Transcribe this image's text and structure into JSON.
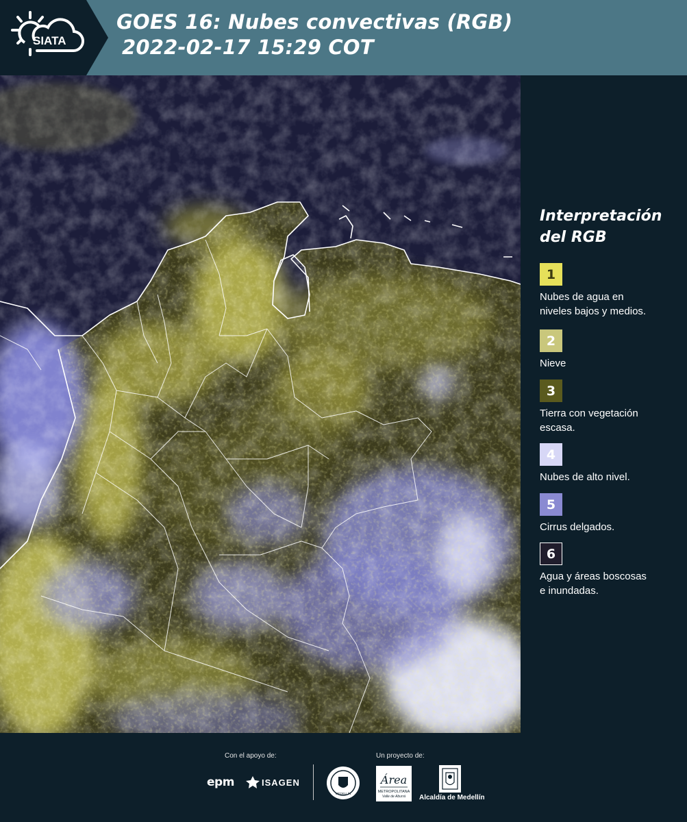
{
  "header": {
    "logo_text": "SIATA",
    "title_line1": "GOES 16: Nubes convectivas (RGB)",
    "title_line2": "2022-02-17 15:29 COT",
    "colors": {
      "bar": "#4c7786",
      "logo_bg": "#0d1f2a"
    }
  },
  "legend": {
    "title_line1": "Interpretación",
    "title_line2": "del RGB",
    "items": [
      {
        "number": "1",
        "color": "#e6e05a",
        "text_color": "#3a3a10",
        "lines": [
          "Nubes de agua en",
          "niveles bajos y medios."
        ]
      },
      {
        "number": "2",
        "color": "#c9c77c",
        "text_color": "#ffffff",
        "lines": [
          "Nieve"
        ]
      },
      {
        "number": "3",
        "color": "#5a5a1e",
        "text_color": "#ffffff",
        "lines": [
          "Tierra con vegetación",
          "escasa."
        ]
      },
      {
        "number": "4",
        "color": "#d7d7f6",
        "text_color": "#ffffff",
        "lines": [
          "Nubes de alto nivel."
        ]
      },
      {
        "number": "5",
        "color": "#8a8ad2",
        "text_color": "#ffffff",
        "lines": [
          "Cirrus delgados."
        ]
      },
      {
        "number": "6",
        "color": "#201d2c",
        "text_color": "#ffffff",
        "lines": [
          "Agua y áreas boscosas",
          "e inundadas."
        ]
      }
    ]
  },
  "footer": {
    "support_label": "Con el apoyo de:",
    "project_label": "Un proyecto de:",
    "sponsor_epm": "epm",
    "sponsor_isagen": "ISAGEN",
    "area_logo_text": "Área",
    "area_caption_1": "METROPOLITANA",
    "area_caption_2": "Valle de Aburrá",
    "seal_caption": "MEDELLÍN",
    "alcaldia_text": "Alcaldía de Medellín"
  },
  "map": {
    "colors": {
      "ocean": "#1c1d3a",
      "land_dark": "#3d3c1e",
      "land_olive": "#6b6a2c",
      "cloud_yellow": "#d8d460",
      "cloud_blue": "#8d8fe0",
      "cloud_white": "#e6e8fb",
      "borders": "#ffffff"
    }
  }
}
